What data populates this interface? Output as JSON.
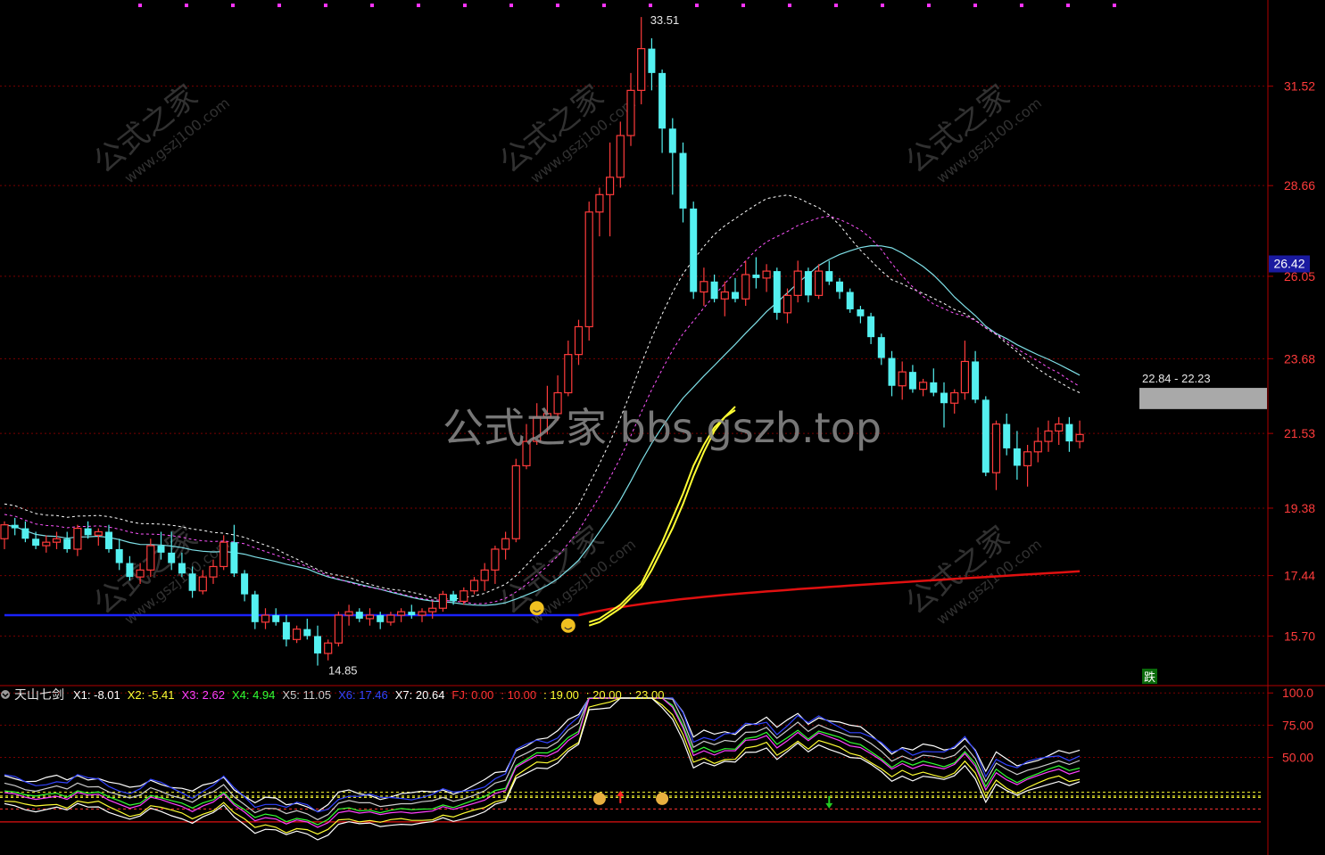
{
  "chart_data": [
    {
      "type": "candlestick",
      "panel": "price",
      "y_ticks": [
        "31.52",
        "28.66",
        "26.05",
        "23.68",
        "21.53",
        "19.38",
        "17.44",
        "15.70"
      ],
      "y_tick_values": [
        31.52,
        28.66,
        26.05,
        23.68,
        21.53,
        19.38,
        17.44,
        15.7
      ],
      "ylim": [
        14.3,
        34.0
      ],
      "current_price_label": "26.42",
      "current_price": 26.42,
      "high_annotation": {
        "label": "33.51",
        "value": 33.51,
        "bar": 53
      },
      "low_annotation": {
        "label": "14.85",
        "value": 14.85,
        "bar": 28
      },
      "zone_label": "22.84 - 22.23",
      "zone": [
        22.84,
        22.23
      ],
      "signal_badge": "跌",
      "watermark": "公式之家 bbs.gszb.top",
      "watermark_tiles": [
        "公式之家",
        "www.gszj100.com"
      ],
      "colors": {
        "up": "#ff3b3b",
        "down": "#54f0f0",
        "yellow": "#ffff33",
        "cyan_ma": "#7fe0e8",
        "red_ma": "#e01010",
        "blue_ma": "#1a22ff",
        "grid": "#7a0000"
      },
      "candles": [
        [
          18.5,
          19.0,
          18.2,
          18.9
        ],
        [
          18.9,
          19.1,
          18.6,
          18.8
        ],
        [
          18.8,
          19.0,
          18.4,
          18.5
        ],
        [
          18.5,
          18.7,
          18.2,
          18.3
        ],
        [
          18.3,
          18.6,
          18.1,
          18.4
        ],
        [
          18.4,
          18.7,
          18.2,
          18.5
        ],
        [
          18.5,
          18.7,
          18.1,
          18.2
        ],
        [
          18.2,
          18.9,
          18.0,
          18.8
        ],
        [
          18.8,
          19.0,
          18.5,
          18.6
        ],
        [
          18.6,
          18.8,
          18.3,
          18.7
        ],
        [
          18.7,
          18.9,
          18.1,
          18.2
        ],
        [
          18.2,
          18.5,
          17.6,
          17.8
        ],
        [
          17.8,
          18.0,
          17.3,
          17.4
        ],
        [
          17.4,
          17.8,
          17.2,
          17.6
        ],
        [
          17.6,
          18.5,
          17.4,
          18.3
        ],
        [
          18.3,
          18.7,
          17.9,
          18.1
        ],
        [
          18.1,
          18.7,
          17.6,
          17.8
        ],
        [
          17.8,
          18.1,
          17.4,
          17.5
        ],
        [
          17.5,
          17.7,
          16.8,
          17.0
        ],
        [
          17.0,
          17.6,
          16.9,
          17.4
        ],
        [
          17.4,
          17.9,
          17.2,
          17.7
        ],
        [
          17.7,
          18.6,
          17.6,
          18.4
        ],
        [
          18.4,
          18.9,
          17.4,
          17.5
        ],
        [
          17.5,
          17.6,
          16.7,
          16.9
        ],
        [
          16.9,
          17.0,
          15.9,
          16.1
        ],
        [
          16.1,
          16.5,
          15.9,
          16.3
        ],
        [
          16.3,
          16.5,
          16.0,
          16.1
        ],
        [
          16.1,
          16.3,
          15.4,
          15.6
        ],
        [
          15.6,
          16.0,
          15.5,
          15.9
        ],
        [
          15.9,
          16.2,
          15.6,
          15.7
        ],
        [
          15.7,
          16.0,
          14.85,
          15.2
        ],
        [
          15.2,
          15.6,
          15.0,
          15.5
        ],
        [
          15.5,
          16.4,
          15.4,
          16.3
        ],
        [
          16.3,
          16.6,
          16.0,
          16.4
        ],
        [
          16.4,
          16.5,
          16.1,
          16.2
        ],
        [
          16.2,
          16.5,
          16.0,
          16.3
        ],
        [
          16.3,
          16.4,
          15.9,
          16.1
        ],
        [
          16.1,
          16.4,
          16.0,
          16.3
        ],
        [
          16.3,
          16.5,
          16.1,
          16.4
        ],
        [
          16.4,
          16.6,
          16.2,
          16.3
        ],
        [
          16.3,
          16.5,
          16.1,
          16.4
        ],
        [
          16.4,
          16.7,
          16.2,
          16.5
        ],
        [
          16.5,
          17.0,
          16.4,
          16.9
        ],
        [
          16.9,
          17.0,
          16.6,
          16.7
        ],
        [
          16.7,
          17.1,
          16.6,
          17.0
        ],
        [
          17.0,
          17.4,
          16.9,
          17.3
        ],
        [
          17.3,
          17.8,
          17.0,
          17.6
        ],
        [
          17.6,
          18.3,
          17.2,
          18.2
        ],
        [
          18.2,
          18.7,
          17.9,
          18.5
        ],
        [
          18.5,
          20.8,
          18.4,
          20.6
        ],
        [
          20.6,
          21.8,
          20.5,
          21.3
        ],
        [
          21.3,
          22.4,
          21.2,
          22.0
        ],
        [
          22.0,
          22.9,
          21.5,
          22.1
        ],
        [
          22.1,
          23.2,
          21.9,
          22.7
        ],
        [
          22.7,
          24.2,
          22.6,
          23.8
        ],
        [
          23.8,
          24.8,
          23.5,
          24.6
        ],
        [
          24.6,
          28.2,
          24.2,
          27.9
        ],
        [
          27.9,
          28.6,
          27.2,
          28.4
        ],
        [
          28.4,
          29.9,
          27.2,
          28.9
        ],
        [
          28.9,
          30.5,
          28.6,
          30.1
        ],
        [
          30.1,
          31.9,
          29.8,
          31.4
        ],
        [
          31.4,
          33.51,
          31.0,
          32.6
        ],
        [
          32.6,
          32.9,
          31.4,
          31.9
        ],
        [
          31.9,
          32.0,
          29.6,
          30.3
        ],
        [
          30.3,
          30.6,
          28.4,
          29.6
        ],
        [
          29.6,
          29.9,
          27.6,
          28.0
        ],
        [
          28.0,
          28.2,
          25.4,
          25.6
        ],
        [
          25.6,
          26.3,
          25.2,
          25.9
        ],
        [
          25.9,
          26.1,
          25.3,
          25.4
        ],
        [
          25.4,
          25.9,
          24.9,
          25.6
        ],
        [
          25.6,
          26.0,
          25.3,
          25.4
        ],
        [
          25.4,
          26.5,
          25.2,
          26.1
        ],
        [
          26.1,
          26.6,
          25.7,
          26.0
        ],
        [
          26.0,
          26.4,
          25.6,
          26.2
        ],
        [
          26.2,
          26.3,
          24.8,
          25.0
        ],
        [
          25.0,
          25.7,
          24.7,
          25.5
        ],
        [
          25.5,
          26.5,
          25.3,
          26.2
        ],
        [
          26.2,
          26.3,
          25.3,
          25.5
        ],
        [
          25.5,
          26.4,
          25.4,
          26.2
        ],
        [
          26.2,
          26.5,
          25.8,
          25.9
        ],
        [
          25.9,
          26.0,
          25.4,
          25.6
        ],
        [
          25.6,
          25.7,
          25.0,
          25.1
        ],
        [
          25.1,
          25.2,
          24.7,
          24.9
        ],
        [
          24.9,
          25.0,
          24.1,
          24.3
        ],
        [
          24.3,
          24.4,
          23.5,
          23.7
        ]
      ],
      "series": [
        {
          "name": "X1",
          "color": "#ffffff",
          "values": [
            16.1,
            16.2,
            16.4,
            16.6,
            16.9,
            17.2,
            17.8,
            18.4,
            19.1,
            19.8,
            20.6,
            21.2,
            21.7,
            22.0,
            22.2
          ]
        },
        {
          "name": "X2",
          "color": "#ffff33",
          "values": [
            16.0,
            16.1,
            16.3,
            16.5,
            16.8,
            17.1,
            17.6,
            18.2,
            18.8,
            19.5,
            20.3,
            21.0,
            21.6,
            22.0,
            22.3
          ]
        }
      ]
    },
    {
      "type": "line",
      "panel": "indicator",
      "title": "天山七剑",
      "legend": [
        {
          "key": "X1",
          "label": "X1: -8.01",
          "color": "#ffffff"
        },
        {
          "key": "X2",
          "label": "X2: -5.41",
          "color": "#ffff33"
        },
        {
          "key": "X3",
          "label": "X3: 2.62",
          "color": "#ff40ff"
        },
        {
          "key": "X4",
          "label": "X4: 4.94",
          "color": "#33ff33"
        },
        {
          "key": "X5",
          "label": "X5: 11.05",
          "color": "#cccccc"
        },
        {
          "key": "X6",
          "label": "X6: 17.46",
          "color": "#3344ff"
        },
        {
          "key": "X7",
          "label": "X7: 20.64",
          "color": "#ffffff"
        },
        {
          "key": "FJ",
          "label": "FJ: 0.00",
          "color": "#ff3333"
        },
        {
          "key": "L10",
          "label": ": 10.00",
          "color": "#ff3333"
        },
        {
          "key": "L19",
          "label": ": 19.00",
          "color": "#ffff33"
        },
        {
          "key": "L20",
          "label": ": 20.00",
          "color": "#ffff33"
        },
        {
          "key": "L23",
          "label": ": 23.00",
          "color": "#ffff33"
        }
      ],
      "y_ticks": [
        "100.0",
        "75.00",
        "50.00"
      ],
      "y_tick_values": [
        100,
        75,
        50
      ],
      "ylim": [
        -25,
        105
      ],
      "reference_lines": [
        0,
        10,
        19,
        20,
        23
      ],
      "current_values": {
        "X1": -8.01,
        "X2": -5.41,
        "X3": 2.62,
        "X4": 4.94,
        "X5": 11.05,
        "X6": 17.46,
        "X7": 20.64,
        "FJ": 0.0
      }
    }
  ]
}
